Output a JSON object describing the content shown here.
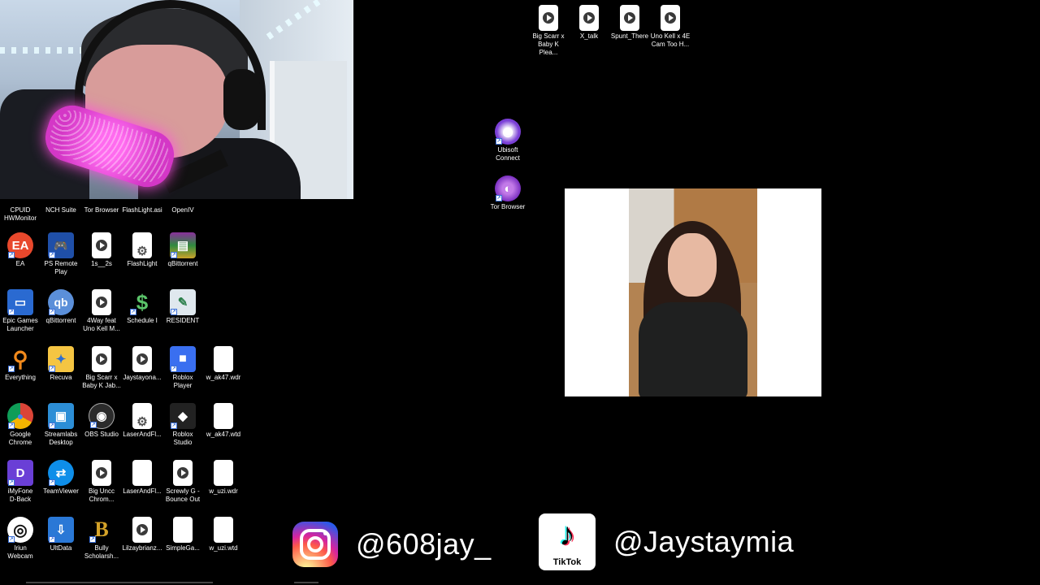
{
  "webcam": {
    "icon": "person-webcam-feed"
  },
  "desktop_icons": [
    {
      "id": "cpuid",
      "label": "CPUID\nHWMonitor",
      "icon": "cpuid-icon",
      "kind": "partial"
    },
    {
      "id": "nch",
      "label": "NCH Suite",
      "icon": "nch-icon",
      "kind": "partial"
    },
    {
      "id": "tor1",
      "label": "Tor Browser",
      "icon": "tor-icon",
      "kind": "partial"
    },
    {
      "id": "flashlight-asi",
      "label": "FlashLight.asi",
      "icon": "file-icon",
      "kind": "partial"
    },
    {
      "id": "openiv",
      "label": "OpenIV",
      "icon": "openiv-icon",
      "kind": "partial"
    },
    {
      "id": "ea",
      "label": "EA",
      "icon": "ea-icon"
    },
    {
      "id": "ps-remote",
      "label": "PS Remote\nPlay",
      "icon": "ps-remote-icon"
    },
    {
      "id": "1s2s",
      "label": "1s__2s",
      "icon": "media-file-icon"
    },
    {
      "id": "flashlight",
      "label": "FlashLight",
      "icon": "settings-file-icon"
    },
    {
      "id": "qbit1",
      "label": "qBittorrent",
      "icon": "winrar-icon"
    },
    {
      "id": "epic",
      "label": "Epic Games\nLauncher",
      "icon": "epic-games-icon"
    },
    {
      "id": "qbit2",
      "label": "qBittorrent",
      "icon": "qbittorrent-icon"
    },
    {
      "id": "4way",
      "label": "4Way feat\nUno Kell M...",
      "icon": "media-file-icon"
    },
    {
      "id": "schedule1",
      "label": "Schedule I",
      "icon": "schedule-icon"
    },
    {
      "id": "resident",
      "label": "RESIDENT",
      "icon": "notepad-icon"
    },
    {
      "id": "everything",
      "label": "Everything",
      "icon": "search-icon"
    },
    {
      "id": "recuva",
      "label": "Recuva",
      "icon": "recuva-icon"
    },
    {
      "id": "bigscarr2",
      "label": "Big Scarr x\nBaby K Jab...",
      "icon": "media-file-icon"
    },
    {
      "id": "jaystayona",
      "label": "Jaystayona...",
      "icon": "media-file-icon"
    },
    {
      "id": "roblox-player",
      "label": "Roblox\nPlayer",
      "icon": "roblox-icon"
    },
    {
      "id": "wak47wdr",
      "label": "w_ak47.wdr",
      "icon": "file-icon"
    },
    {
      "id": "chrome",
      "label": "Google\nChrome",
      "icon": "chrome-icon"
    },
    {
      "id": "streamlabs",
      "label": "Streamlabs\nDesktop",
      "icon": "streamlabs-icon"
    },
    {
      "id": "obs",
      "label": "OBS Studio",
      "icon": "obs-icon"
    },
    {
      "id": "laserandfl1",
      "label": "LaserAndFl...",
      "icon": "settings-file-icon"
    },
    {
      "id": "roblox-studio",
      "label": "Roblox\nStudio",
      "icon": "roblox-studio-icon"
    },
    {
      "id": "wak47wtd",
      "label": "w_ak47.wtd",
      "icon": "file-icon"
    },
    {
      "id": "imyfone",
      "label": "iMyFone\nD-Back",
      "icon": "imyfone-icon"
    },
    {
      "id": "teamviewer",
      "label": "TeamViewer",
      "icon": "teamviewer-icon"
    },
    {
      "id": "bigunc",
      "label": "Big Uncc\nChrom...",
      "icon": "media-file-icon"
    },
    {
      "id": "laserandfl2",
      "label": "LaserAndFl...",
      "icon": "file-icon"
    },
    {
      "id": "screwly",
      "label": "Screwly G -\nBounce Out",
      "icon": "media-file-icon"
    },
    {
      "id": "wuziwdr",
      "label": "w_uzi.wdr",
      "icon": "file-icon"
    },
    {
      "id": "iriun",
      "label": "Iriun\nWebcam",
      "icon": "iriun-icon"
    },
    {
      "id": "ultdata",
      "label": "UltData",
      "icon": "ultdata-icon"
    },
    {
      "id": "bully",
      "label": "Bully\nScholarsh...",
      "icon": "bully-icon"
    },
    {
      "id": "lilzay",
      "label": "Lilzaybrianz...",
      "icon": "media-file-icon"
    },
    {
      "id": "simplega",
      "label": "SimpleGa...",
      "icon": "file-icon"
    },
    {
      "id": "wuziwtd",
      "label": "w_uzi.wtd",
      "icon": "file-icon"
    },
    {
      "id": "bigscarr1",
      "label": "Big Scarr x\nBaby K Plea...",
      "icon": "media-file-icon"
    },
    {
      "id": "xtalk",
      "label": "X_talk",
      "icon": "media-file-icon"
    },
    {
      "id": "spunt",
      "label": "Spunt_There",
      "icon": "media-file-icon"
    },
    {
      "id": "unokell",
      "label": "Uno Kell x 4E\nCam Too H...",
      "icon": "media-file-icon"
    },
    {
      "id": "ubisoft",
      "label": "Ubisoft\nConnect",
      "icon": "ubisoft-icon"
    },
    {
      "id": "tor2",
      "label": "Tor Browser",
      "icon": "tor-icon"
    }
  ],
  "photo": {
    "icon": "portrait-photo"
  },
  "socials": {
    "instagram": {
      "handle": "@608jay_",
      "icon": "instagram-icon"
    },
    "tiktok": {
      "handle": "@Jaystaymia",
      "icon": "tiktok-icon",
      "logo_text": "TikTok"
    }
  }
}
